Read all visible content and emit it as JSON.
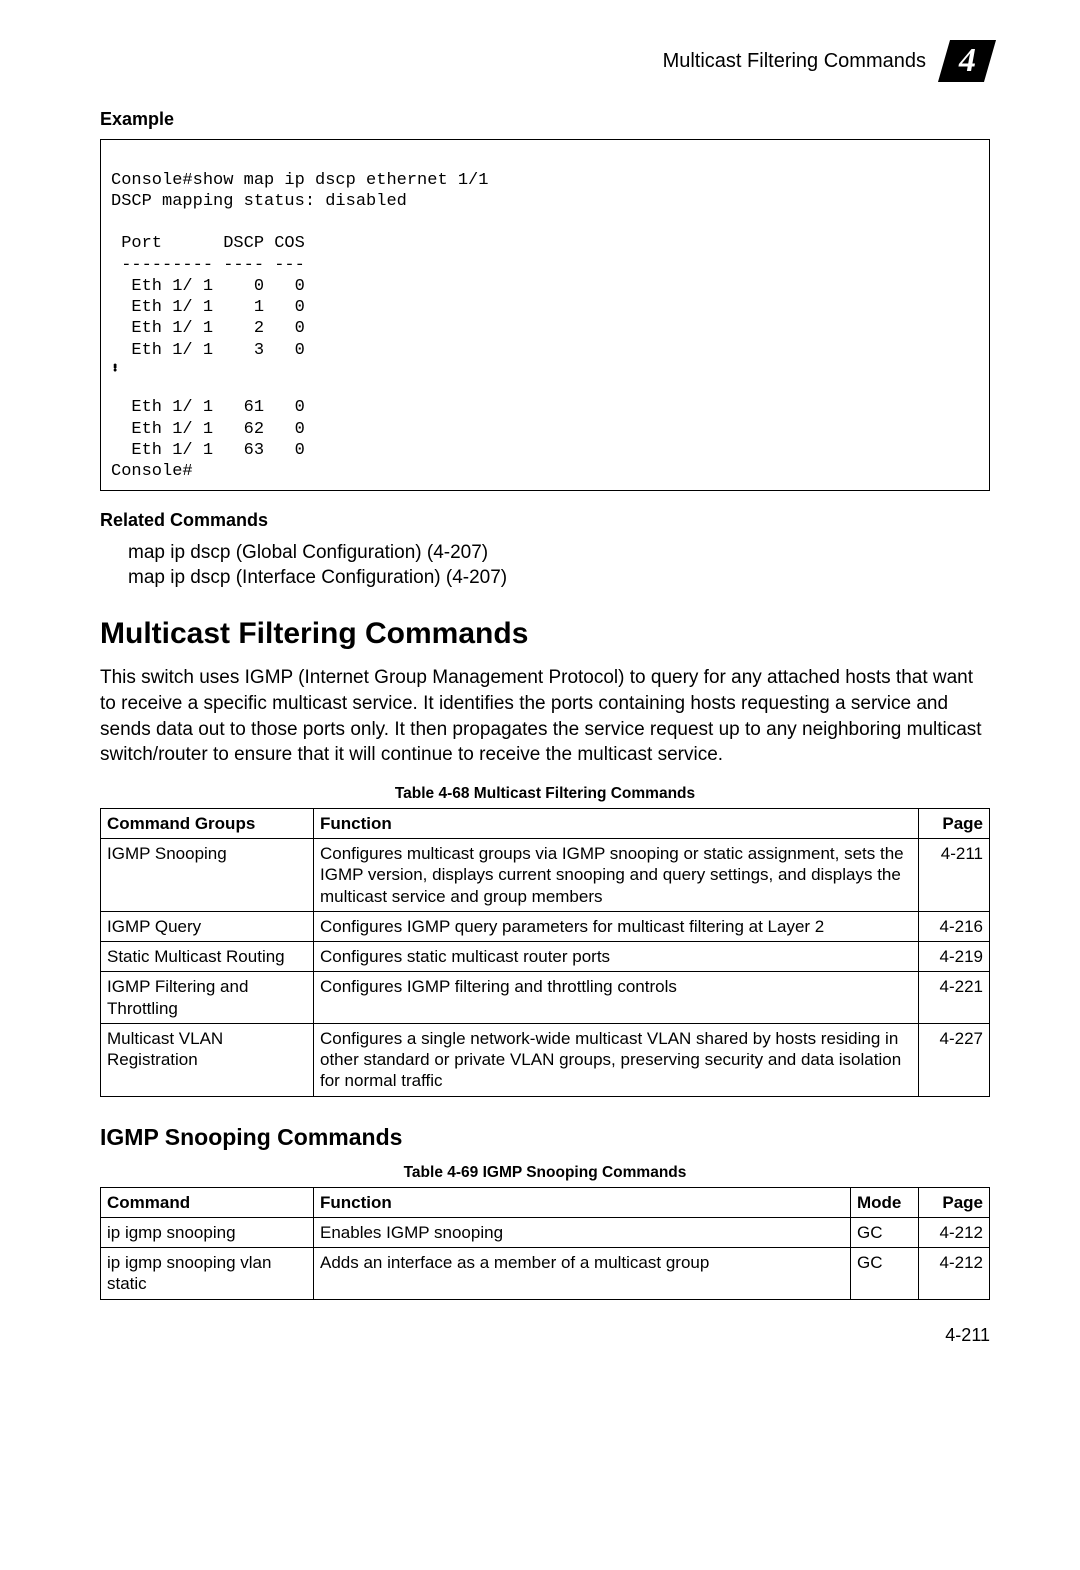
{
  "header": {
    "title": "Multicast Filtering Commands",
    "chapter": "4"
  },
  "example": {
    "label": "Example",
    "code_top": "Console#show map ip dscp ethernet 1/1\nDSCP mapping status: disabled\n\n Port      DSCP COS\n --------- ---- ---\n  Eth 1/ 1    0   0\n  Eth 1/ 1    1   0\n  Eth 1/ 1    2   0\n  Eth 1/ 1    3   0",
    "code_bottom": "  Eth 1/ 1   61   0\n  Eth 1/ 1   62   0\n  Eth 1/ 1   63   0\nConsole#"
  },
  "related": {
    "label": "Related Commands",
    "line1": "map ip dscp (Global Configuration) (4-207)",
    "line2": "map ip dscp (Interface Configuration) (4-207)"
  },
  "main_heading": "Multicast Filtering Commands",
  "intro_para": "This switch uses IGMP (Internet Group Management Protocol) to query for any attached hosts that want to receive a specific multicast service. It identifies the ports containing hosts requesting a service and sends data out to those ports only. It then propagates the service request up to any neighboring multicast switch/router to ensure that it will continue to receive the multicast service.",
  "table68": {
    "caption": "Table 4-68  Multicast Filtering Commands",
    "headers": {
      "c1": "Command Groups",
      "c2": "Function",
      "c3": "Page"
    },
    "rows": [
      {
        "c1": "IGMP Snooping",
        "c2": "Configures multicast groups via IGMP snooping or static assignment, sets the IGMP version, displays current snooping and query settings, and displays the multicast service and group members",
        "c3": "4-211"
      },
      {
        "c1": "IGMP Query",
        "c2": "Configures IGMP query parameters for multicast filtering at Layer 2",
        "c3": "4-216"
      },
      {
        "c1": "Static Multicast Routing",
        "c2": "Configures static multicast router ports",
        "c3": "4-219"
      },
      {
        "c1": "IGMP Filtering and Throttling",
        "c2": "Configures IGMP filtering and throttling controls",
        "c3": "4-221"
      },
      {
        "c1": "Multicast VLAN Registration",
        "c2": "Configures a single network-wide multicast VLAN shared by hosts residing in other standard or private VLAN groups, preserving security and data isolation for normal traffic",
        "c3": "4-227"
      }
    ]
  },
  "sub_heading": "IGMP Snooping Commands",
  "table69": {
    "caption": "Table 4-69  IGMP Snooping Commands",
    "headers": {
      "c1": "Command",
      "c2": "Function",
      "c3": "Mode",
      "c4": "Page"
    },
    "rows": [
      {
        "c1": "ip igmp snooping",
        "c2": "Enables IGMP snooping",
        "c3": "GC",
        "c4": "4-212"
      },
      {
        "c1": "ip igmp snooping vlan static",
        "c2": "Adds an interface as a member of a multicast group",
        "c3": "GC",
        "c4": "4-212"
      }
    ]
  },
  "page_number": "4-211"
}
